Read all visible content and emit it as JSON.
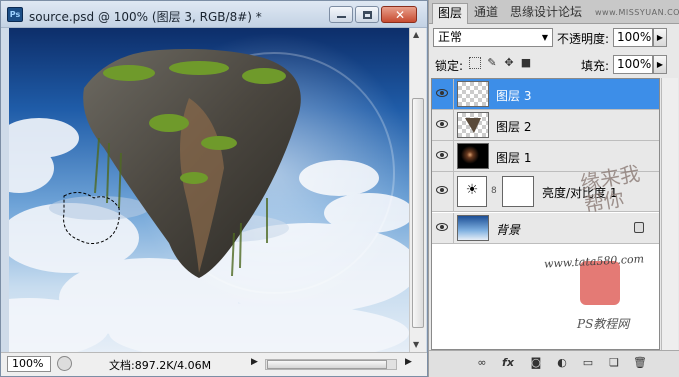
{
  "document": {
    "app_icon": "ps-app-icon",
    "app_icon_text": "Ps",
    "title": "source.psd @ 100% (图层 3, RGB/8#) *",
    "zoom": "100%",
    "doc_info": "文档:897.2K/4.06M"
  },
  "panel": {
    "tabs": [
      "图层",
      "通道",
      "思缘设计论坛"
    ],
    "site_watermark": "www.MISSYUAN.COM",
    "blend_mode": "正常",
    "opacity_label": "不透明度:",
    "opacity": "100%",
    "lock_label": "锁定:",
    "fill_label": "填充:",
    "fill": "100%",
    "layers": [
      {
        "name": "图层 3",
        "selected": true,
        "thumb": "transparent-rock"
      },
      {
        "name": "图层 2",
        "selected": false,
        "thumb": "rock-outline"
      },
      {
        "name": "图层 1",
        "selected": false,
        "thumb": "dark-flare"
      },
      {
        "name": "亮度/对比度 1",
        "selected": false,
        "thumb": "adjustment"
      },
      {
        "name": "背景",
        "selected": false,
        "thumb": "sky"
      }
    ]
  },
  "watermark": {
    "handwriting": "缘来我帮你",
    "text": "PS教程网",
    "url": "www.tata580.com"
  },
  "colors": {
    "selection": "#3d8ee8",
    "panel_bg": "#e8e8e8",
    "title_bg": "#c3d2e4"
  }
}
